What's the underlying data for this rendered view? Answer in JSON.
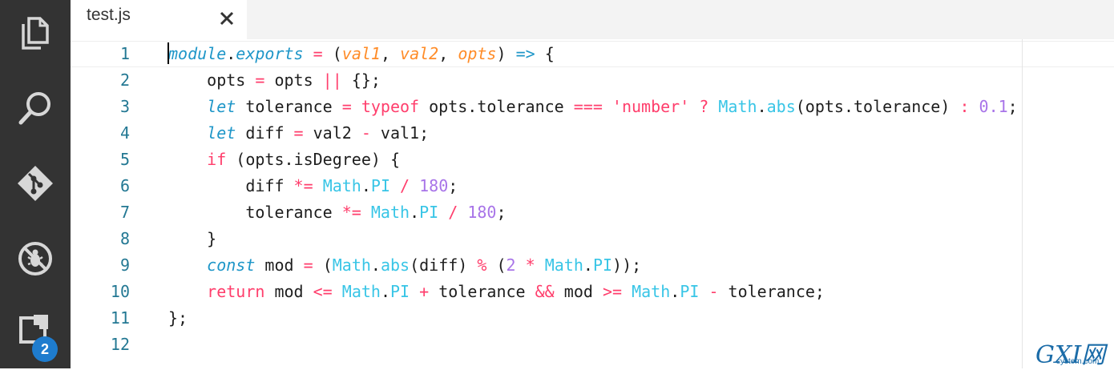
{
  "activity_bar": {
    "items": [
      {
        "name": "explorer",
        "icon": "files-icon"
      },
      {
        "name": "search",
        "icon": "search-icon"
      },
      {
        "name": "source-control",
        "icon": "git-icon"
      },
      {
        "name": "debug",
        "icon": "no-bug-icon"
      },
      {
        "name": "extensions",
        "icon": "extensions-icon",
        "badge": "2"
      }
    ],
    "background": "#333333",
    "icon_color": "#d7d7d7",
    "badge_color": "#1e7cce"
  },
  "tab": {
    "title": "test.js",
    "close_icon": "close-icon"
  },
  "editor": {
    "line_numbers": [
      "1",
      "2",
      "3",
      "4",
      "5",
      "6",
      "7",
      "8",
      "9",
      "10",
      "11",
      "12"
    ],
    "lines": [
      [
        {
          "t": "module",
          "c": "var"
        },
        {
          "t": ".",
          "c": "plain"
        },
        {
          "t": "exports",
          "c": "var"
        },
        {
          "t": " ",
          "c": "plain"
        },
        {
          "t": "=",
          "c": "op"
        },
        {
          "t": " (",
          "c": "plain"
        },
        {
          "t": "val1",
          "c": "param"
        },
        {
          "t": ", ",
          "c": "plain"
        },
        {
          "t": "val2",
          "c": "param"
        },
        {
          "t": ", ",
          "c": "plain"
        },
        {
          "t": "opts",
          "c": "param"
        },
        {
          "t": ") ",
          "c": "plain"
        },
        {
          "t": "=>",
          "c": "kw-i"
        },
        {
          "t": " {",
          "c": "plain"
        }
      ],
      [
        {
          "t": "    opts ",
          "c": "plain"
        },
        {
          "t": "=",
          "c": "op"
        },
        {
          "t": " opts ",
          "c": "plain"
        },
        {
          "t": "||",
          "c": "op"
        },
        {
          "t": " {};",
          "c": "plain"
        }
      ],
      [
        {
          "t": "    ",
          "c": "plain"
        },
        {
          "t": "let",
          "c": "kw-i"
        },
        {
          "t": " tolerance ",
          "c": "plain"
        },
        {
          "t": "=",
          "c": "op"
        },
        {
          "t": " ",
          "c": "plain"
        },
        {
          "t": "typeof",
          "c": "kw"
        },
        {
          "t": " opts.tolerance ",
          "c": "plain"
        },
        {
          "t": "===",
          "c": "op"
        },
        {
          "t": " ",
          "c": "plain"
        },
        {
          "t": "'number'",
          "c": "str"
        },
        {
          "t": " ",
          "c": "plain"
        },
        {
          "t": "?",
          "c": "op"
        },
        {
          "t": " ",
          "c": "plain"
        },
        {
          "t": "Math",
          "c": "math"
        },
        {
          "t": ".",
          "c": "plain"
        },
        {
          "t": "abs",
          "c": "math"
        },
        {
          "t": "(opts.tolerance) ",
          "c": "plain"
        },
        {
          "t": ":",
          "c": "op"
        },
        {
          "t": " ",
          "c": "plain"
        },
        {
          "t": "0.1",
          "c": "num"
        },
        {
          "t": ";",
          "c": "plain"
        }
      ],
      [
        {
          "t": "    ",
          "c": "plain"
        },
        {
          "t": "let",
          "c": "kw-i"
        },
        {
          "t": " diff ",
          "c": "plain"
        },
        {
          "t": "=",
          "c": "op"
        },
        {
          "t": " val2 ",
          "c": "plain"
        },
        {
          "t": "-",
          "c": "op"
        },
        {
          "t": " val1;",
          "c": "plain"
        }
      ],
      [
        {
          "t": "    ",
          "c": "plain"
        },
        {
          "t": "if",
          "c": "kw"
        },
        {
          "t": " (opts.isDegree) {",
          "c": "plain"
        }
      ],
      [
        {
          "t": "        diff ",
          "c": "plain"
        },
        {
          "t": "*=",
          "c": "op"
        },
        {
          "t": " ",
          "c": "plain"
        },
        {
          "t": "Math",
          "c": "math"
        },
        {
          "t": ".",
          "c": "plain"
        },
        {
          "t": "PI",
          "c": "math"
        },
        {
          "t": " ",
          "c": "plain"
        },
        {
          "t": "/",
          "c": "op"
        },
        {
          "t": " ",
          "c": "plain"
        },
        {
          "t": "180",
          "c": "num"
        },
        {
          "t": ";",
          "c": "plain"
        }
      ],
      [
        {
          "t": "        tolerance ",
          "c": "plain"
        },
        {
          "t": "*=",
          "c": "op"
        },
        {
          "t": " ",
          "c": "plain"
        },
        {
          "t": "Math",
          "c": "math"
        },
        {
          "t": ".",
          "c": "plain"
        },
        {
          "t": "PI",
          "c": "math"
        },
        {
          "t": " ",
          "c": "plain"
        },
        {
          "t": "/",
          "c": "op"
        },
        {
          "t": " ",
          "c": "plain"
        },
        {
          "t": "180",
          "c": "num"
        },
        {
          "t": ";",
          "c": "plain"
        }
      ],
      [
        {
          "t": "    }",
          "c": "plain"
        }
      ],
      [
        {
          "t": "    ",
          "c": "plain"
        },
        {
          "t": "const",
          "c": "kw-i"
        },
        {
          "t": " mod ",
          "c": "plain"
        },
        {
          "t": "=",
          "c": "op"
        },
        {
          "t": " (",
          "c": "plain"
        },
        {
          "t": "Math",
          "c": "math"
        },
        {
          "t": ".",
          "c": "plain"
        },
        {
          "t": "abs",
          "c": "math"
        },
        {
          "t": "(diff) ",
          "c": "plain"
        },
        {
          "t": "%",
          "c": "op"
        },
        {
          "t": " (",
          "c": "plain"
        },
        {
          "t": "2",
          "c": "num"
        },
        {
          "t": " ",
          "c": "plain"
        },
        {
          "t": "*",
          "c": "op"
        },
        {
          "t": " ",
          "c": "plain"
        },
        {
          "t": "Math",
          "c": "math"
        },
        {
          "t": ".",
          "c": "plain"
        },
        {
          "t": "PI",
          "c": "math"
        },
        {
          "t": "));",
          "c": "plain"
        }
      ],
      [
        {
          "t": "    ",
          "c": "plain"
        },
        {
          "t": "return",
          "c": "kw"
        },
        {
          "t": " mod ",
          "c": "plain"
        },
        {
          "t": "<=",
          "c": "op"
        },
        {
          "t": " ",
          "c": "plain"
        },
        {
          "t": "Math",
          "c": "math"
        },
        {
          "t": ".",
          "c": "plain"
        },
        {
          "t": "PI",
          "c": "math"
        },
        {
          "t": " ",
          "c": "plain"
        },
        {
          "t": "+",
          "c": "op"
        },
        {
          "t": " tolerance ",
          "c": "plain"
        },
        {
          "t": "&&",
          "c": "op"
        },
        {
          "t": " mod ",
          "c": "plain"
        },
        {
          "t": ">=",
          "c": "op"
        },
        {
          "t": " ",
          "c": "plain"
        },
        {
          "t": "Math",
          "c": "math"
        },
        {
          "t": ".",
          "c": "plain"
        },
        {
          "t": "PI",
          "c": "math"
        },
        {
          "t": " ",
          "c": "plain"
        },
        {
          "t": "-",
          "c": "op"
        },
        {
          "t": " tolerance;",
          "c": "plain"
        }
      ],
      [
        {
          "t": "};",
          "c": "plain"
        }
      ],
      []
    ],
    "colors": {
      "keyword": "#ff3e6c",
      "italic_keyword": "#1e96c8",
      "parameter": "#ff8c28",
      "builtin": "#38c5e6",
      "number": "#a874e8",
      "line_number": "#237893"
    }
  },
  "watermark": {
    "main": "GXI网",
    "sub": "system.com"
  }
}
